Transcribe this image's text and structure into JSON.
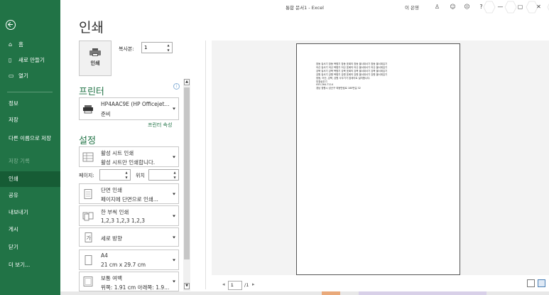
{
  "titlebar": {
    "title": "통합 문서1  -  Excel",
    "user": "이 은영",
    "help": "?",
    "minimize": "—",
    "restore": "▢",
    "close": "✕"
  },
  "rail": {
    "items": [
      {
        "label": "홈",
        "icon": "home-icon"
      },
      {
        "label": "새로 만들기",
        "icon": "new-file-icon"
      },
      {
        "label": "열기",
        "icon": "open-folder-icon"
      },
      {
        "label": "정보"
      },
      {
        "label": "저장"
      },
      {
        "label": "다른 이름으로 저장"
      },
      {
        "label": "저장 기록"
      },
      {
        "label": "인쇄"
      },
      {
        "label": "공유"
      },
      {
        "label": "내보내기"
      },
      {
        "label": "게시"
      },
      {
        "label": "닫기"
      },
      {
        "label": "더 보기..."
      }
    ]
  },
  "print": {
    "heading": "인쇄",
    "print_button": "인쇄",
    "copies_label": "복사본:",
    "copies_value": "1"
  },
  "printer": {
    "section_title": "프린터",
    "info": "i",
    "name": "HP4AAC9E (HP Officejet...",
    "status": "준비",
    "properties_link": "프린터 속성"
  },
  "settings": {
    "section_title": "설정",
    "what": {
      "line1": "활성 시트 인쇄",
      "line2": "활성 시트만 인쇄합니다."
    },
    "pages_label": "페이지:",
    "to_label": "위치",
    "sides": {
      "line1": "단면 인쇄",
      "line2": "페이지에 단면으로 인쇄..."
    },
    "collate": {
      "line1": "한 부씩 인쇄",
      "line2": "1,2,3    1,2,3    1,2,3"
    },
    "orientation": {
      "line1": "세로 방향"
    },
    "paper": {
      "line1": "A4",
      "line2": "21 cm x 29.7 cm"
    },
    "margins": {
      "line1": "보통 여백",
      "line2": "위쪽: 1.91 cm 아래쪽: 1.9..."
    }
  },
  "preview": {
    "rows": [
      "창동 놓서기     창동 복합기    창동 표회의    창동 올사대서기    창동 올서계입기",
      "어산 놓서기     어산 복합기    어산 표회의    어산 올서대서기    어산 올서계입기",
      "강북 놓서기     강북 복합기    강북 표회의    강북 올서대서기    강북 올서계입기",
      "강원 놓서기     강원 복합기    강원 표회의    강원 올서대서기    강원 올서계입기",
      "창동, 어산, 강북, 강원 사무기기 업데이트 설치합니다.",
      "부경상우기",
      "055-264-7114",
      "경남 창원시 성산구 외동반림로 180번길 32"
    ],
    "page_number": "1",
    "page_total": "/1",
    "prev": "◂",
    "next": "▸"
  }
}
